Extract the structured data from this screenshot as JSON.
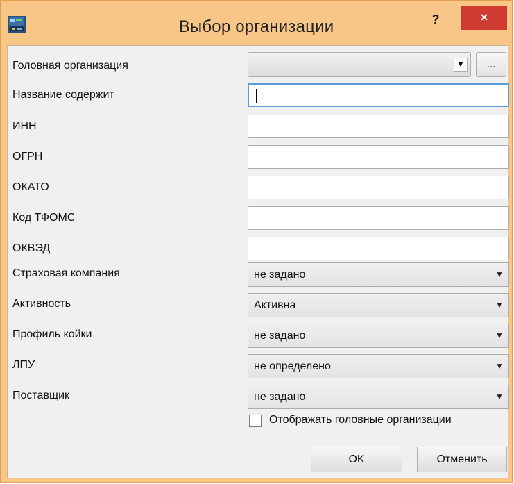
{
  "window": {
    "title": "Выбор организации",
    "help_label": "?",
    "close_label": "×"
  },
  "form": {
    "head_org_label": "Головная организация",
    "head_org_value": "",
    "browse_label": "...",
    "name_label": "Название содержит",
    "name_value": "",
    "inn_label": "ИНН",
    "inn_value": "",
    "ogrn_label": "ОГРН",
    "ogrn_value": "",
    "okato_label": "ОКАТО",
    "okato_value": "",
    "tfoms_label": "Код ТФОМС",
    "tfoms_value": "",
    "okved_label": "ОКВЭД",
    "okved_value": "",
    "insurance_label": "Страховая компания",
    "insurance_value": "не задано",
    "activity_label": "Активность",
    "activity_value": "Активна",
    "bed_profile_label": "Профиль койки",
    "bed_profile_value": "не задано",
    "lpu_label": "ЛПУ",
    "lpu_value": "не определено",
    "supplier_label": "Поставщик",
    "supplier_value": "не задано",
    "show_head_orgs_label": "Отображать головные организации",
    "show_head_orgs_checked": false
  },
  "buttons": {
    "ok_label": "OK",
    "cancel_label": "Отменить"
  },
  "icons": {
    "app": "app-icon",
    "dropdown": "chevron-down-icon"
  },
  "colors": {
    "frame": "#f8c787",
    "close_button": "#cf3a33",
    "focus_border": "#5a9bd8",
    "client_bg": "#f0f0f0"
  }
}
